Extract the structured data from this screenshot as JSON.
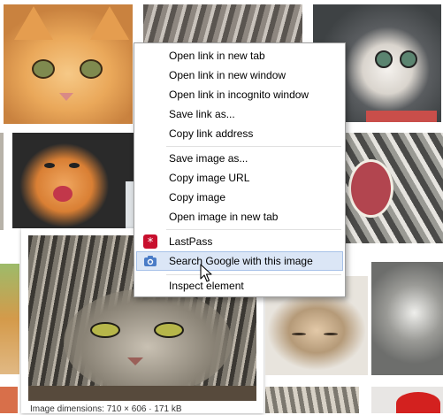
{
  "image_results": {
    "caption": "Image dimensions: 710 × 606 · 171 kB"
  },
  "context_menu": {
    "groups": [
      [
        "Open link in new tab",
        "Open link in new window",
        "Open link in incognito window",
        "Save link as...",
        "Copy link address"
      ],
      [
        "Save image as...",
        "Copy image URL",
        "Copy image",
        "Open image in new tab"
      ],
      [
        "LastPass",
        "Search Google with this image"
      ],
      [
        "Inspect element"
      ]
    ],
    "items": [
      {
        "label": "Open link in new tab"
      },
      {
        "label": "Open link in new window"
      },
      {
        "label": "Open link in incognito window"
      },
      {
        "label": "Save link as..."
      },
      {
        "label": "Copy link address"
      },
      {
        "label": "Save image as..."
      },
      {
        "label": "Copy image URL"
      },
      {
        "label": "Copy image"
      },
      {
        "label": "Open image in new tab"
      },
      {
        "label": "LastPass",
        "icon": "lastpass-icon"
      },
      {
        "label": "Search Google with this image",
        "icon": "camera-icon",
        "highlighted": true
      },
      {
        "label": "Inspect element"
      }
    ]
  },
  "colors": {
    "menu_highlight": "#dbe6f6",
    "menu_highlight_border": "#a7c1e8",
    "lastpass_red": "#c8102e",
    "camera_blue": "#4a7cc7"
  }
}
